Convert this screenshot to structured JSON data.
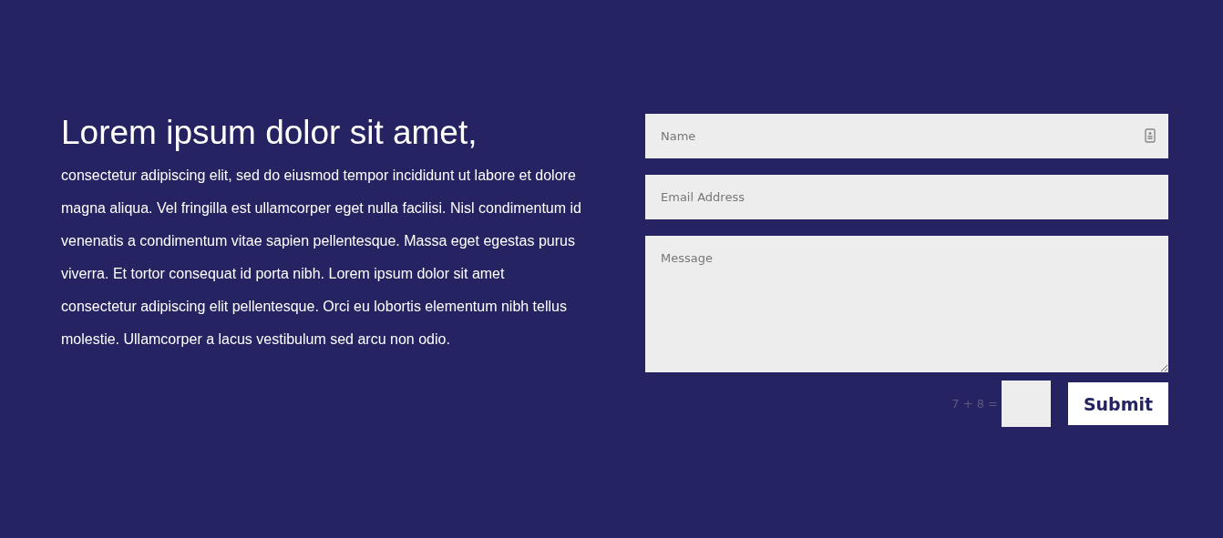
{
  "heading": "Lorem ipsum dolor sit amet,",
  "body": "consectetur adipiscing elit, sed do eiusmod tempor incididunt ut labore et dolore magna aliqua. Vel fringilla est ullamcorper eget nulla facilisi. Nisl condimentum id venenatis a condimentum vitae sapien pellentesque. Massa eget egestas purus viverra. Et tortor consequat id porta nibh. Lorem ipsum dolor sit amet consectetur adipiscing elit pellentesque. Orci eu lobortis elementum nibh tellus molestie. Ullamcorper a lacus vestibulum sed arcu non odio.",
  "form": {
    "name": {
      "placeholder": "Name"
    },
    "email": {
      "placeholder": "Email Address"
    },
    "message": {
      "placeholder": "Message"
    },
    "captcha": {
      "question": "7 + 8 ="
    },
    "submit": "Submit"
  }
}
